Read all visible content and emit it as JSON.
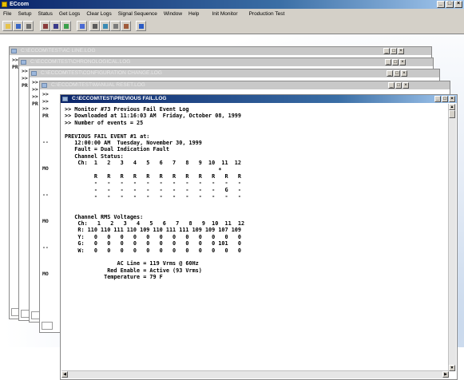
{
  "app": {
    "title": "ECcom",
    "colors": {
      "title_active": "#0a246a",
      "title_gradient_end": "#a6caf0",
      "chrome": "#d4d0c8"
    }
  },
  "menu": [
    "File",
    "Setup",
    "Status",
    "Get Logs",
    "Clear Logs",
    "Signal Sequence",
    "Window",
    "Help",
    "Init Monitor",
    "Production Test"
  ],
  "toolbar": {
    "icons": [
      "open-icon",
      "save-icon",
      "print-icon",
      "tool-a-icon",
      "tool-b-icon",
      "checkmark-icon",
      "clear-icon",
      "list-icon",
      "monitor-icon",
      "grid-icon",
      "reset-icon",
      "help-icon"
    ]
  },
  "children": [
    {
      "title": "C:\\ECCOM\\TEST\\AC LINE.LOG",
      "prefix": [
        ">>",
        "PR"
      ]
    },
    {
      "title": "C:\\ECCOM\\TEST\\CHRONOLOGICAL.LOG",
      "prefix": [
        ">>",
        ">>",
        "PR"
      ]
    },
    {
      "title": "C:\\ECCOM\\TEST\\CONFIGURATION CHANGE.LOG",
      "prefix": [
        ">>",
        ">>",
        ">>",
        "PR"
      ]
    },
    {
      "title": "C:\\ECCOM\\TEST\\MANUAL RESET.LOG",
      "prefix": [
        ">>",
        ">>",
        ">>",
        "PR",
        "--",
        "MO",
        "--",
        "MO",
        "--",
        "MO"
      ]
    }
  ],
  "active": {
    "title": "C:\\ECCOM\\TEST\\PREVIOUS FAIL.LOG",
    "lines": [
      ">> Monitor #73 Previous Fail Event Log",
      ">> Downloaded at 11:16:03 AM  Friday, October 08, 1999",
      ">> Number of events = 25",
      "",
      "PREVIOUS FAIL EVENT #1 at:",
      "   12:00:00 AM  Tuesday, November 30, 1999",
      "   Fault = Dual Indication Fault",
      "   Channel Status:",
      "    Ch:  1   2   3   4   5   6   7   8   9  10  11  12",
      "                                               *",
      "         R   R   R   R   R   R   R   R   R   R   R   R",
      "         -   -   -   -   -   -   -   -   -   -   -   -",
      "         -   -   -   -   -   -   -   -   -   -   G   -",
      "         -   -   -   -   -   -   -   -   -   -   -   -",
      "",
      "",
      "   Channel RMS Voltages:",
      "    Ch:   1   2   3   4   5   6   7   8   9  10  11  12",
      "    R: 110 110 111 110 109 110 111 111 109 109 107 109",
      "    Y:   0   0   0   0   0   0   0   0   0   0   0   0",
      "    G:   0   0   0   0   0   0   0   0   0   0 101   0",
      "    W:   0   0   0   0   0   0   0   0   0   0   0   0",
      "",
      "                AC Line = 119 Vrms @ 60Hz",
      "             Red Enable = Active (93 Vrms)",
      "            Temperature = 79 F"
    ]
  }
}
